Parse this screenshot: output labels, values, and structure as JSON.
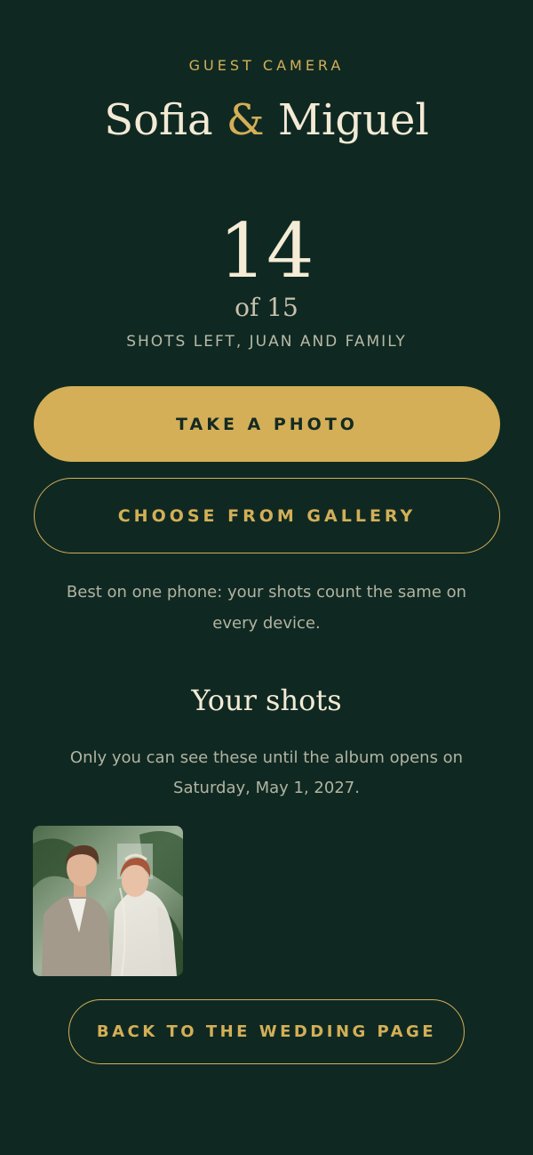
{
  "header": {
    "eyebrow": "GUEST CAMERA",
    "couple_first": "Sofia",
    "couple_amp": "&",
    "couple_second": "Miguel"
  },
  "counter": {
    "remaining": "14",
    "of_total": "of 15",
    "caption": "SHOTS LEFT, JUAN AND FAMILY"
  },
  "actions": {
    "take_photo": "TAKE A PHOTO",
    "choose_gallery": "CHOOSE FROM GALLERY",
    "hint": "Best on one phone: your shots count the same on every device."
  },
  "shots": {
    "title": "Your shots",
    "subtitle": "Only you can see these until the album opens on Saturday, May 1, 2027.",
    "items": [
      {
        "kind": "photo",
        "subject": "couple-portrait"
      }
    ]
  },
  "footer": {
    "back_label": "BACK TO THE WEDDING PAGE"
  },
  "colors": {
    "background": "#0f2922",
    "accent_gold": "#d4af57",
    "text_cream": "#f3ead5",
    "text_muted": "#b2b3a2"
  }
}
